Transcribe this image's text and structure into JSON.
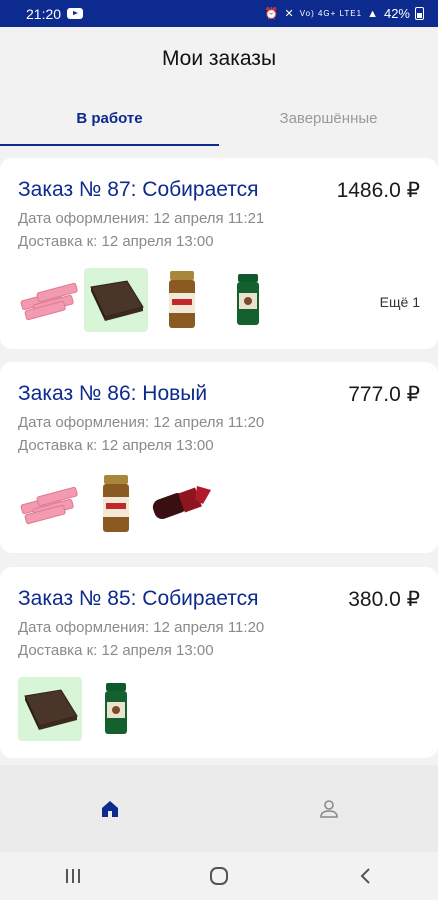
{
  "status_bar": {
    "time": "21:20",
    "network": "Vo) 4G+ LTE1",
    "battery": "42%"
  },
  "header": {
    "title": "Мои заказы"
  },
  "tabs": [
    {
      "label": "В работе",
      "active": true
    },
    {
      "label": "Завершённые",
      "active": false
    }
  ],
  "orders": [
    {
      "title": "Заказ № 87: Собирается",
      "price": "1486.0 ₽",
      "date": "Дата оформления: 12 апреля 11:21",
      "delivery": "Доставка к: 12 апреля 13:00",
      "products": [
        "pink-candy",
        "chocolate-bar",
        "coffee-jar-gold",
        "coffee-jar-green"
      ],
      "more": "Ещё 1"
    },
    {
      "title": "Заказ № 86: Новый",
      "price": "777.0 ₽",
      "date": "Дата оформления: 12 апреля 11:20",
      "delivery": "Доставка к: 12 апреля 13:00",
      "products": [
        "pink-candy",
        "coffee-jar-gold",
        "lipstick"
      ]
    },
    {
      "title": "Заказ № 85: Собирается",
      "price": "380.0 ₽",
      "date": "Дата оформления: 12 апреля 11:20",
      "delivery": "Доставка к: 12 апреля 13:00",
      "products": [
        "chocolate-bar",
        "coffee-jar-green"
      ]
    }
  ],
  "bottom_nav": [
    {
      "icon": "home-icon",
      "active": true
    },
    {
      "icon": "profile-icon",
      "active": false
    }
  ],
  "colors": {
    "accent": "#0d2a8f",
    "highlight": "#d9f5d8",
    "muted": "#8a8a8a"
  }
}
